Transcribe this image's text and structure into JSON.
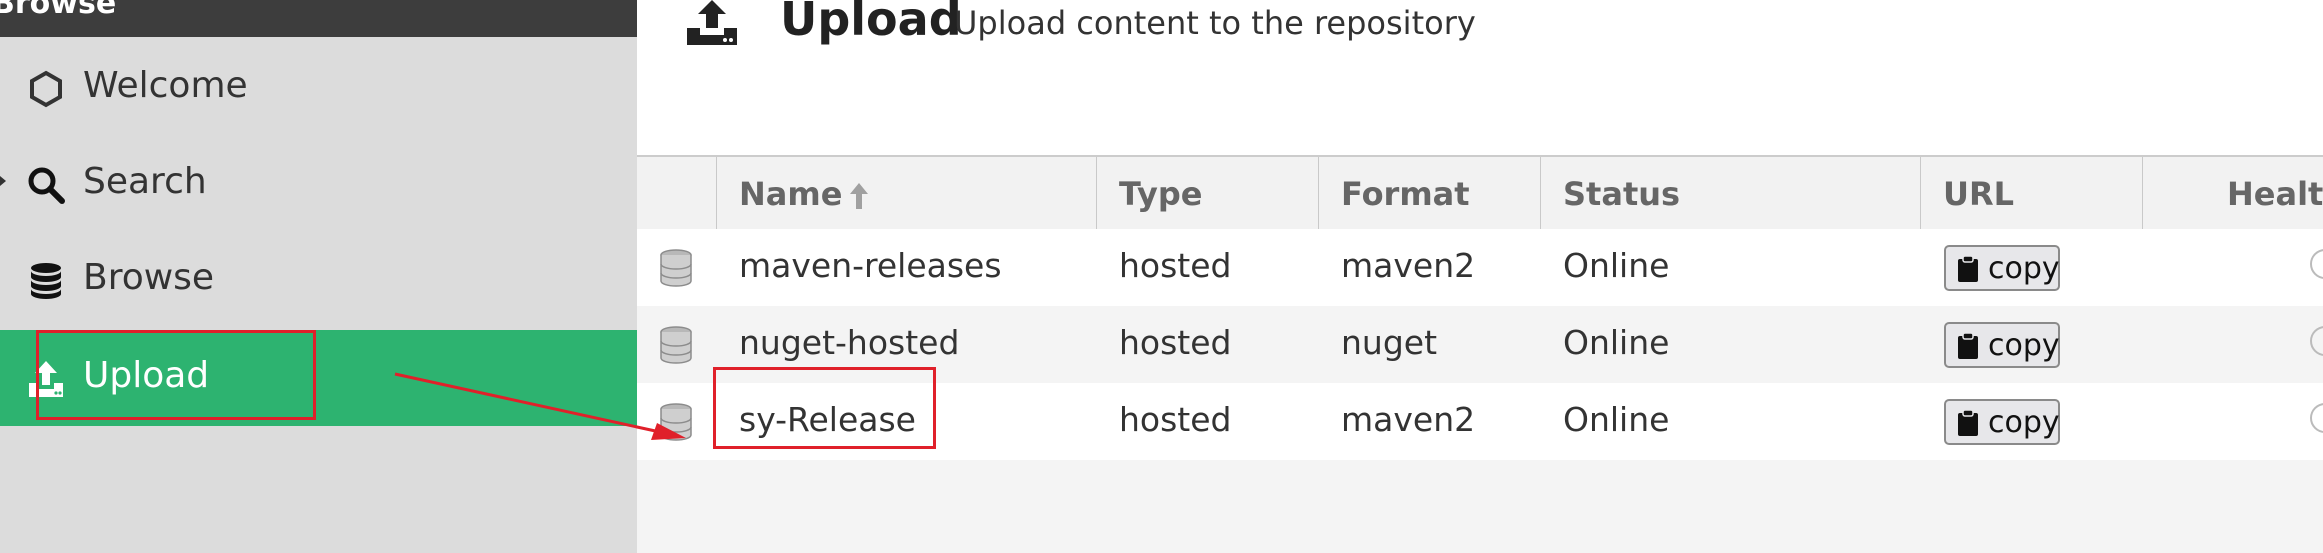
{
  "sidebar": {
    "header": "Browse",
    "items": [
      {
        "label": "Welcome",
        "icon": "hexagon-icon"
      },
      {
        "label": "Search",
        "icon": "search-icon"
      },
      {
        "label": "Browse",
        "icon": "database-icon"
      },
      {
        "label": "Upload",
        "icon": "upload-icon",
        "active": true
      }
    ]
  },
  "page": {
    "title": "Upload",
    "subtitle": "Upload content to the repository"
  },
  "table": {
    "columns": [
      "Name",
      "Type",
      "Format",
      "Status",
      "URL",
      "Health"
    ],
    "copy_label": "copy",
    "rows": [
      {
        "name": "maven-releases",
        "type": "hosted",
        "format": "maven2",
        "status": "Online"
      },
      {
        "name": "nuget-hosted",
        "type": "hosted",
        "format": "nuget",
        "status": "Online"
      },
      {
        "name": "sy-Release",
        "type": "hosted",
        "format": "maven2",
        "status": "Online"
      }
    ]
  },
  "colors": {
    "active_nav": "#2db370",
    "sidebar_bg": "#dcdcdc",
    "header_bar": "#3d3d3d",
    "annotation": "#e0202a"
  }
}
